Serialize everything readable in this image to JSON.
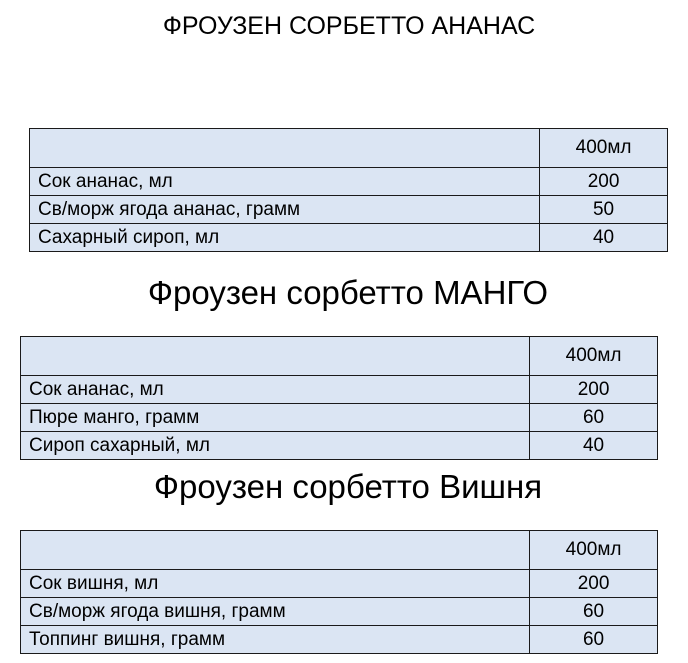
{
  "recipes": [
    {
      "title": "ФРОУЗЕН СОРБЕТТО АНАНАС",
      "volume": "400мл",
      "rows": [
        {
          "name": "Сок ананас, мл",
          "value": "200"
        },
        {
          "name": "Св/морж ягода ананас, грамм",
          "value": "50"
        },
        {
          "name": "Сахарный сироп, мл",
          "value": "40"
        }
      ]
    },
    {
      "title": "Фроузен сорбетто МАНГО",
      "volume": "400мл",
      "rows": [
        {
          "name": "Сок ананас, мл",
          "value": "200"
        },
        {
          "name": "Пюре манго, грамм",
          "value": "60"
        },
        {
          "name": "Сироп сахарный, мл",
          "value": "40"
        }
      ]
    },
    {
      "title": "Фроузен сорбетто Вишня",
      "volume": "400мл",
      "rows": [
        {
          "name": "Сок вишня, мл",
          "value": "200"
        },
        {
          "name": "Св/морж ягода вишня, грамм",
          "value": "60"
        },
        {
          "name": "Топпинг вишня, грамм",
          "value": "60"
        }
      ]
    }
  ]
}
